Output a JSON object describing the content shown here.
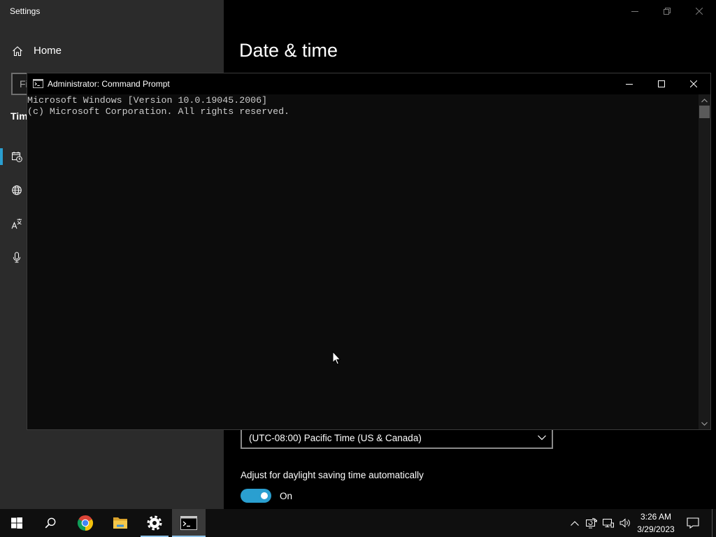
{
  "settings": {
    "window_title": "Settings",
    "home_label": "Home",
    "search_placeholder": "Fi",
    "section_heading": "Tim",
    "nav_items": [
      {
        "icon": "date-time-icon",
        "selected": true
      },
      {
        "icon": "region-icon",
        "selected": false
      },
      {
        "icon": "language-icon",
        "selected": false
      },
      {
        "icon": "speech-icon",
        "selected": false
      }
    ],
    "page_title": "Date & time",
    "time_zone": {
      "value": "(UTC-08:00) Pacific Time (US & Canada)"
    },
    "daylight_saving": {
      "label": "Adjust for daylight saving time automatically",
      "state_label": "On",
      "enabled": true
    }
  },
  "command_prompt": {
    "title": "Administrator: Command Prompt",
    "output_lines": [
      "Microsoft Windows [Version 10.0.19045.2006]",
      "(c) Microsoft Corporation. All rights reserved."
    ]
  },
  "taskbar": {
    "buttons": [
      {
        "icon": "start-icon"
      },
      {
        "icon": "search-icon"
      },
      {
        "icon": "chrome-icon"
      },
      {
        "icon": "file-explorer-icon"
      },
      {
        "icon": "settings-gear-icon",
        "running": true
      },
      {
        "icon": "command-prompt-icon",
        "running": true,
        "active": true
      }
    ],
    "tray_icons": [
      "chevron-up-icon",
      "sync-icon",
      "network-icon",
      "volume-icon"
    ],
    "clock": {
      "time": "3:26 AM",
      "date": "3/29/2023"
    },
    "notification_icon": "notification-icon"
  },
  "colors": {
    "accent": "#2a9fd0",
    "sidebar_bg": "#2b2b2b",
    "content_bg": "#000000",
    "console_bg": "#0c0c0c",
    "console_text": "#cccccc",
    "taskbar_bg": "#0f0f0f",
    "active_task_bg": "#3a3a3a",
    "running_indicator": "#8fc3e8"
  }
}
